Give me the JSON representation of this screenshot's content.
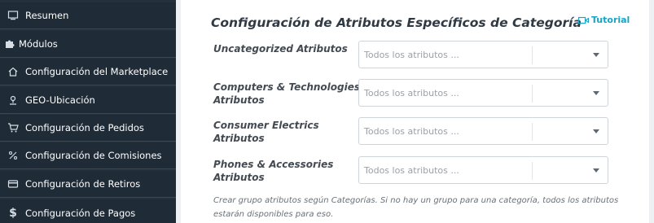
{
  "sidebar": {
    "items": [
      {
        "label": "Resumen",
        "icon": "monitor-icon"
      },
      {
        "label": "Módulos",
        "icon": "puzzle-icon"
      },
      {
        "label": "Configuración del Marketplace",
        "icon": "home-icon"
      },
      {
        "label": "GEO-Ubicación",
        "icon": "location-icon"
      },
      {
        "label": "Configuración de Pedidos",
        "icon": "cart-icon"
      },
      {
        "label": "Configuración de Comisiones",
        "icon": "percent-icon"
      },
      {
        "label": "Configuración de Retiros",
        "icon": "credit-card-icon"
      },
      {
        "label": "Configuración de Pagos",
        "icon": "dollar-icon"
      }
    ]
  },
  "main": {
    "title": "Configuración de Atributos Específicos de Categoría",
    "tutorial_label": "Tutorial",
    "rows": [
      {
        "label": "Uncategorized Atributos",
        "placeholder": "Todos los atributos ..."
      },
      {
        "label": "Computers & Technologies Atributos",
        "placeholder": "Todos los atributos ..."
      },
      {
        "label": "Consumer Electrics Atributos",
        "placeholder": "Todos los atributos ..."
      },
      {
        "label": "Phones & Accessories Atributos",
        "placeholder": "Todos los atributos ..."
      }
    ],
    "help_text": "Crear grupo atributos según Categorías. Si no hay un grupo para una categoría, todos los atributos estarán disponibles para eso."
  },
  "colors": {
    "sidebar_bg": "#1f2b36",
    "accent": "#1aa3c6",
    "title": "#2f3a44"
  }
}
